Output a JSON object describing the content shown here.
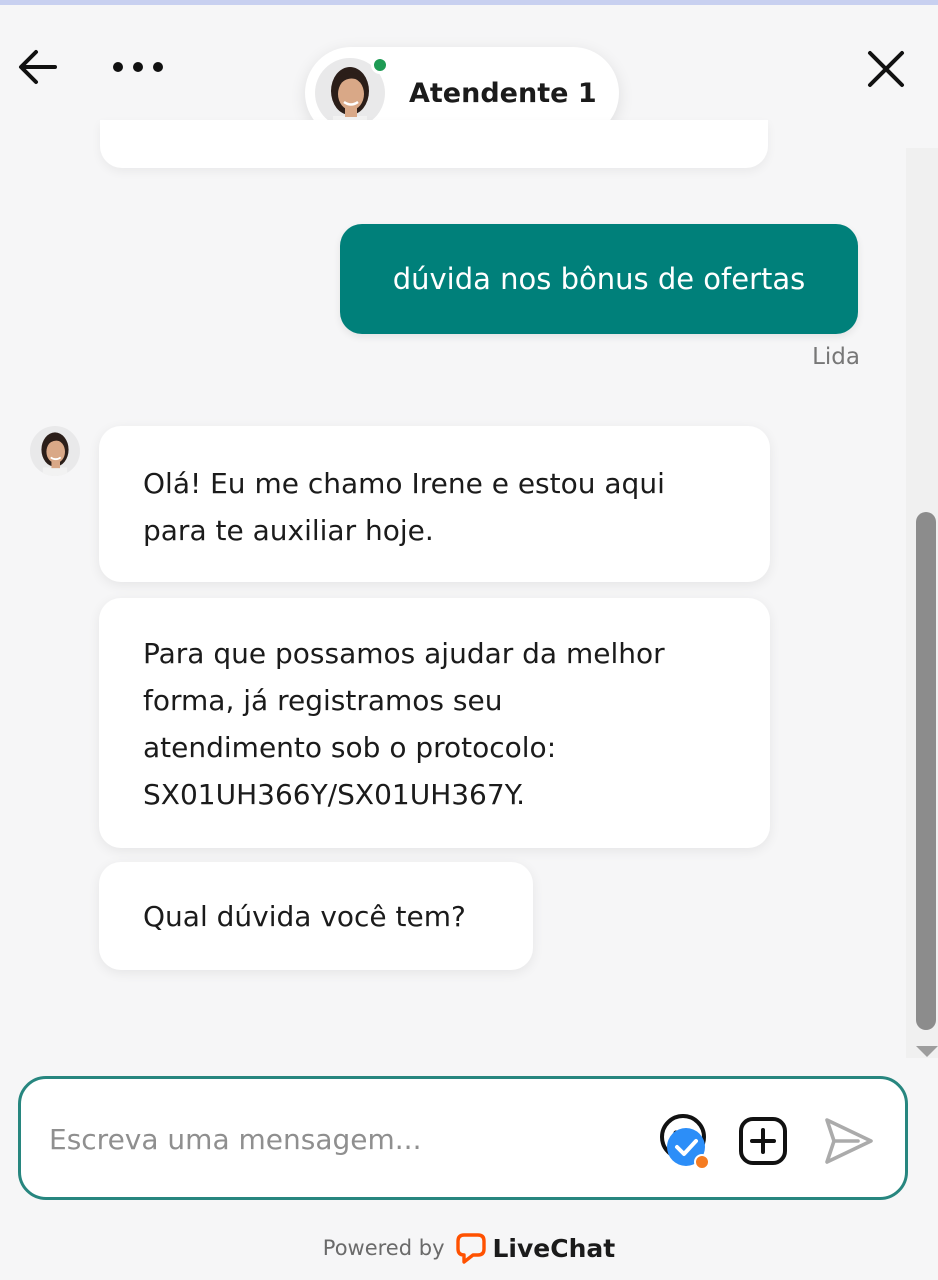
{
  "header": {
    "agent_name": "Atendente 1",
    "status_color": "#1e9b54",
    "icons": {
      "back": "arrow-left-icon",
      "more": "more-horizontal-icon",
      "close": "close-icon"
    }
  },
  "messages": {
    "user": {
      "text": "dúvida nos bônus de ofertas",
      "status": "Lida",
      "bubble_color": "#00807a"
    },
    "agent": [
      {
        "lines": [
          "Olá! Eu me chamo Irene e estou aqui",
          "para te auxiliar hoje."
        ]
      },
      {
        "lines": [
          "Para que possamos ajudar da melhor",
          "forma, já registramos seu",
          "atendimento sob o protocolo:",
          "SX01UH366Y/SX01UH367Y."
        ]
      },
      {
        "lines": [
          "Qual dúvida você tem?"
        ]
      }
    ]
  },
  "composer": {
    "placeholder": "Escreva uma mensagem...",
    "value": "",
    "border_color": "#27867f",
    "icons": {
      "emoji": "emoji-icon",
      "attach": "add-attachment-icon",
      "send": "send-icon"
    }
  },
  "footer": {
    "powered_by": "Powered by",
    "brand": "LiveChat",
    "brand_color": "#ff5100"
  }
}
